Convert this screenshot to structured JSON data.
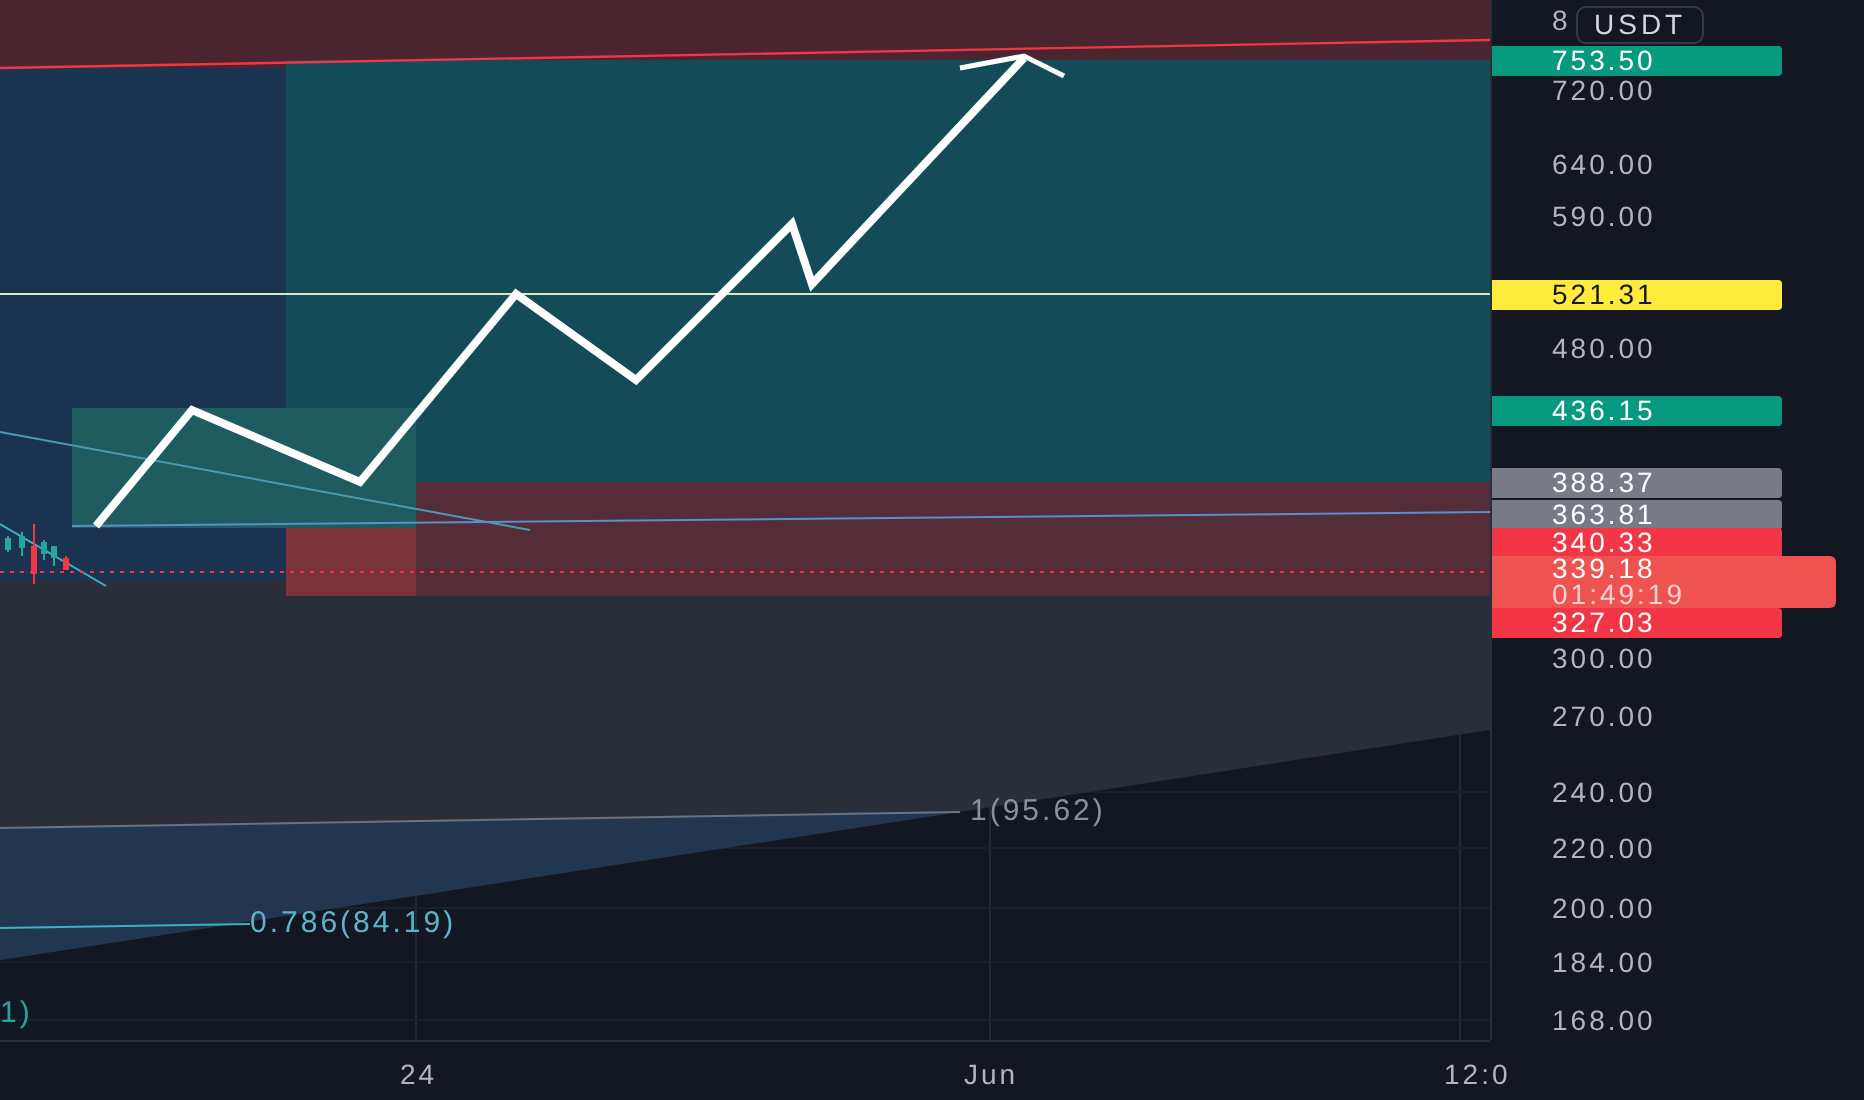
{
  "price_axis": {
    "currency": "USDT",
    "partial_tick": "8",
    "ticks": [
      "720.00",
      "640.00",
      "590.00",
      "480.00",
      "300.00",
      "270.00",
      "240.00",
      "220.00",
      "200.00",
      "184.00",
      "168.00"
    ],
    "markers": [
      {
        "price": "753.50",
        "color": "#089981"
      },
      {
        "price": "521.31",
        "color": "#ffeb3b"
      },
      {
        "price": "436.15",
        "color": "#089981"
      },
      {
        "price": "388.37",
        "color": "#787b86"
      },
      {
        "price": "363.81",
        "color": "#787b86"
      },
      {
        "price": "340.33",
        "color": "#f23645"
      },
      {
        "price": "327.03",
        "color": "#f23645"
      }
    ],
    "last_price": {
      "price": "339.18",
      "countdown": "01:49:19"
    }
  },
  "time_axis": {
    "ticks": [
      "24",
      "Jun",
      "12:0"
    ]
  },
  "fib_labels": [
    "1(95.62)",
    "0.786(84.19)",
    "1)"
  ]
}
